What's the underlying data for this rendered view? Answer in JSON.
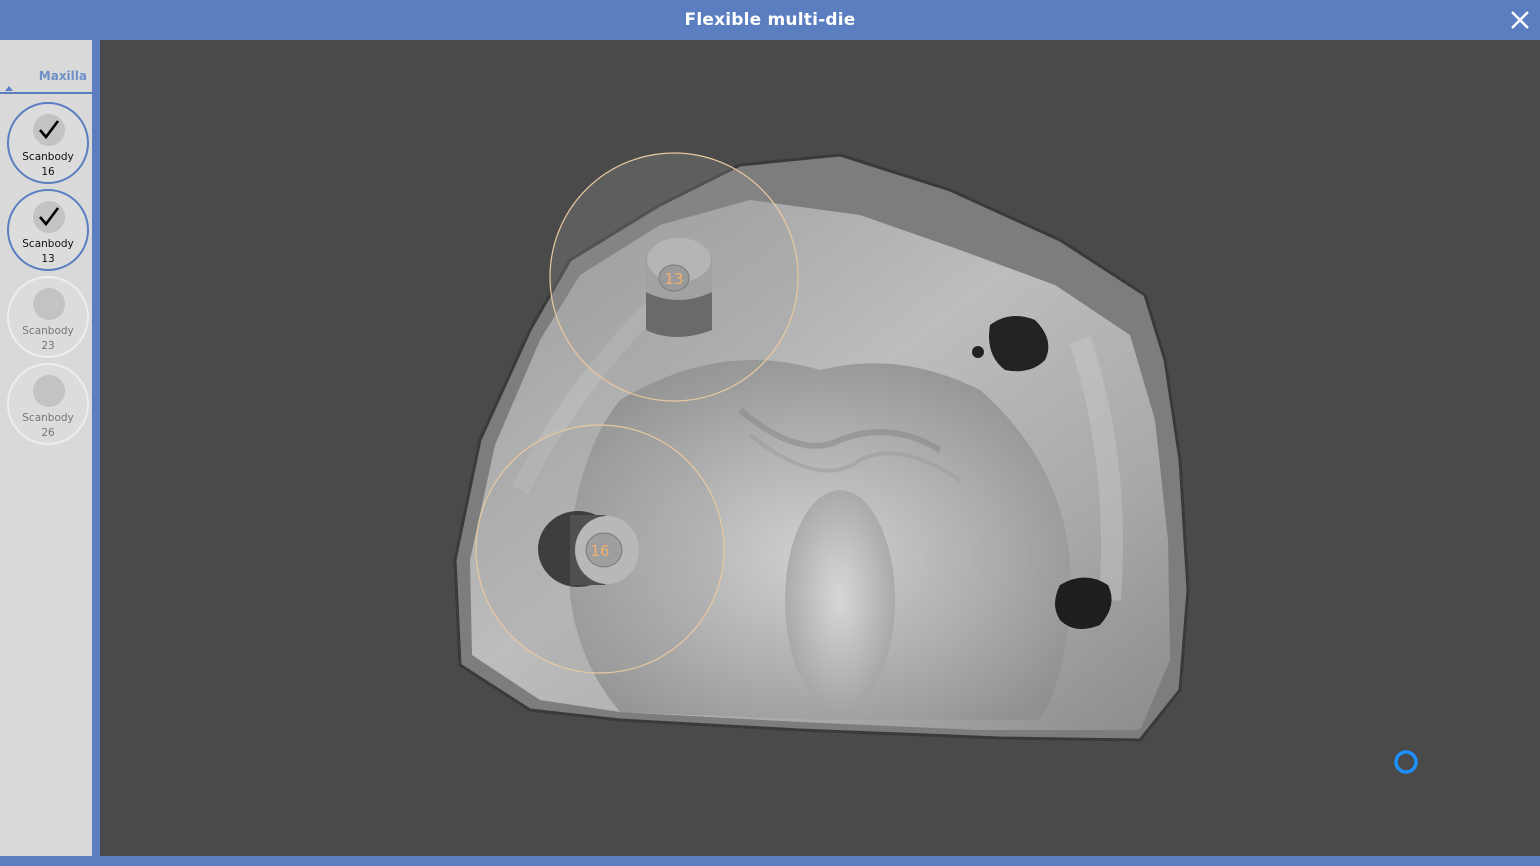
{
  "window": {
    "title": "Flexible multi-die"
  },
  "sidebar": {
    "tab_label": "Maxilla",
    "items": [
      {
        "label": "Scanbody",
        "number": "16",
        "status": "done"
      },
      {
        "label": "Scanbody",
        "number": "13",
        "status": "done"
      },
      {
        "label": "Scanbody",
        "number": "23",
        "status": "pending"
      },
      {
        "label": "Scanbody",
        "number": "26",
        "status": "pending"
      }
    ]
  },
  "viewport": {
    "markers": [
      {
        "label": "13"
      },
      {
        "label": "16"
      }
    ]
  },
  "colors": {
    "accent": "#5b7ec0",
    "viewport_bg": "#4a4a4a",
    "marker_ring": "#e8c8a0",
    "marker_text": "#f0b070",
    "loading_ring": "#1e90ff"
  },
  "icons": {
    "close": "close-icon",
    "done": "checkmark-icon",
    "loading": "loading-spinner-icon"
  }
}
